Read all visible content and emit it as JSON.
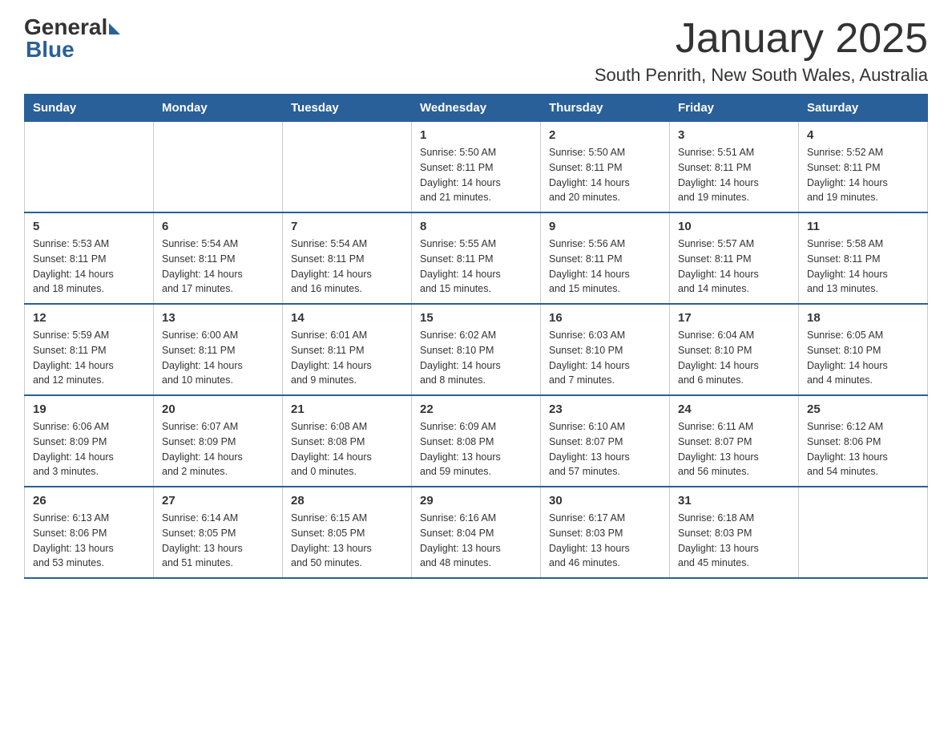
{
  "logo": {
    "general": "General",
    "arrow": "",
    "blue": "Blue"
  },
  "title": "January 2025",
  "location": "South Penrith, New South Wales, Australia",
  "days_of_week": [
    "Sunday",
    "Monday",
    "Tuesday",
    "Wednesday",
    "Thursday",
    "Friday",
    "Saturday"
  ],
  "weeks": [
    [
      {
        "day": "",
        "info": ""
      },
      {
        "day": "",
        "info": ""
      },
      {
        "day": "",
        "info": ""
      },
      {
        "day": "1",
        "info": "Sunrise: 5:50 AM\nSunset: 8:11 PM\nDaylight: 14 hours\nand 21 minutes."
      },
      {
        "day": "2",
        "info": "Sunrise: 5:50 AM\nSunset: 8:11 PM\nDaylight: 14 hours\nand 20 minutes."
      },
      {
        "day": "3",
        "info": "Sunrise: 5:51 AM\nSunset: 8:11 PM\nDaylight: 14 hours\nand 19 minutes."
      },
      {
        "day": "4",
        "info": "Sunrise: 5:52 AM\nSunset: 8:11 PM\nDaylight: 14 hours\nand 19 minutes."
      }
    ],
    [
      {
        "day": "5",
        "info": "Sunrise: 5:53 AM\nSunset: 8:11 PM\nDaylight: 14 hours\nand 18 minutes."
      },
      {
        "day": "6",
        "info": "Sunrise: 5:54 AM\nSunset: 8:11 PM\nDaylight: 14 hours\nand 17 minutes."
      },
      {
        "day": "7",
        "info": "Sunrise: 5:54 AM\nSunset: 8:11 PM\nDaylight: 14 hours\nand 16 minutes."
      },
      {
        "day": "8",
        "info": "Sunrise: 5:55 AM\nSunset: 8:11 PM\nDaylight: 14 hours\nand 15 minutes."
      },
      {
        "day": "9",
        "info": "Sunrise: 5:56 AM\nSunset: 8:11 PM\nDaylight: 14 hours\nand 15 minutes."
      },
      {
        "day": "10",
        "info": "Sunrise: 5:57 AM\nSunset: 8:11 PM\nDaylight: 14 hours\nand 14 minutes."
      },
      {
        "day": "11",
        "info": "Sunrise: 5:58 AM\nSunset: 8:11 PM\nDaylight: 14 hours\nand 13 minutes."
      }
    ],
    [
      {
        "day": "12",
        "info": "Sunrise: 5:59 AM\nSunset: 8:11 PM\nDaylight: 14 hours\nand 12 minutes."
      },
      {
        "day": "13",
        "info": "Sunrise: 6:00 AM\nSunset: 8:11 PM\nDaylight: 14 hours\nand 10 minutes."
      },
      {
        "day": "14",
        "info": "Sunrise: 6:01 AM\nSunset: 8:11 PM\nDaylight: 14 hours\nand 9 minutes."
      },
      {
        "day": "15",
        "info": "Sunrise: 6:02 AM\nSunset: 8:10 PM\nDaylight: 14 hours\nand 8 minutes."
      },
      {
        "day": "16",
        "info": "Sunrise: 6:03 AM\nSunset: 8:10 PM\nDaylight: 14 hours\nand 7 minutes."
      },
      {
        "day": "17",
        "info": "Sunrise: 6:04 AM\nSunset: 8:10 PM\nDaylight: 14 hours\nand 6 minutes."
      },
      {
        "day": "18",
        "info": "Sunrise: 6:05 AM\nSunset: 8:10 PM\nDaylight: 14 hours\nand 4 minutes."
      }
    ],
    [
      {
        "day": "19",
        "info": "Sunrise: 6:06 AM\nSunset: 8:09 PM\nDaylight: 14 hours\nand 3 minutes."
      },
      {
        "day": "20",
        "info": "Sunrise: 6:07 AM\nSunset: 8:09 PM\nDaylight: 14 hours\nand 2 minutes."
      },
      {
        "day": "21",
        "info": "Sunrise: 6:08 AM\nSunset: 8:08 PM\nDaylight: 14 hours\nand 0 minutes."
      },
      {
        "day": "22",
        "info": "Sunrise: 6:09 AM\nSunset: 8:08 PM\nDaylight: 13 hours\nand 59 minutes."
      },
      {
        "day": "23",
        "info": "Sunrise: 6:10 AM\nSunset: 8:07 PM\nDaylight: 13 hours\nand 57 minutes."
      },
      {
        "day": "24",
        "info": "Sunrise: 6:11 AM\nSunset: 8:07 PM\nDaylight: 13 hours\nand 56 minutes."
      },
      {
        "day": "25",
        "info": "Sunrise: 6:12 AM\nSunset: 8:06 PM\nDaylight: 13 hours\nand 54 minutes."
      }
    ],
    [
      {
        "day": "26",
        "info": "Sunrise: 6:13 AM\nSunset: 8:06 PM\nDaylight: 13 hours\nand 53 minutes."
      },
      {
        "day": "27",
        "info": "Sunrise: 6:14 AM\nSunset: 8:05 PM\nDaylight: 13 hours\nand 51 minutes."
      },
      {
        "day": "28",
        "info": "Sunrise: 6:15 AM\nSunset: 8:05 PM\nDaylight: 13 hours\nand 50 minutes."
      },
      {
        "day": "29",
        "info": "Sunrise: 6:16 AM\nSunset: 8:04 PM\nDaylight: 13 hours\nand 48 minutes."
      },
      {
        "day": "30",
        "info": "Sunrise: 6:17 AM\nSunset: 8:03 PM\nDaylight: 13 hours\nand 46 minutes."
      },
      {
        "day": "31",
        "info": "Sunrise: 6:18 AM\nSunset: 8:03 PM\nDaylight: 13 hours\nand 45 minutes."
      },
      {
        "day": "",
        "info": ""
      }
    ]
  ]
}
